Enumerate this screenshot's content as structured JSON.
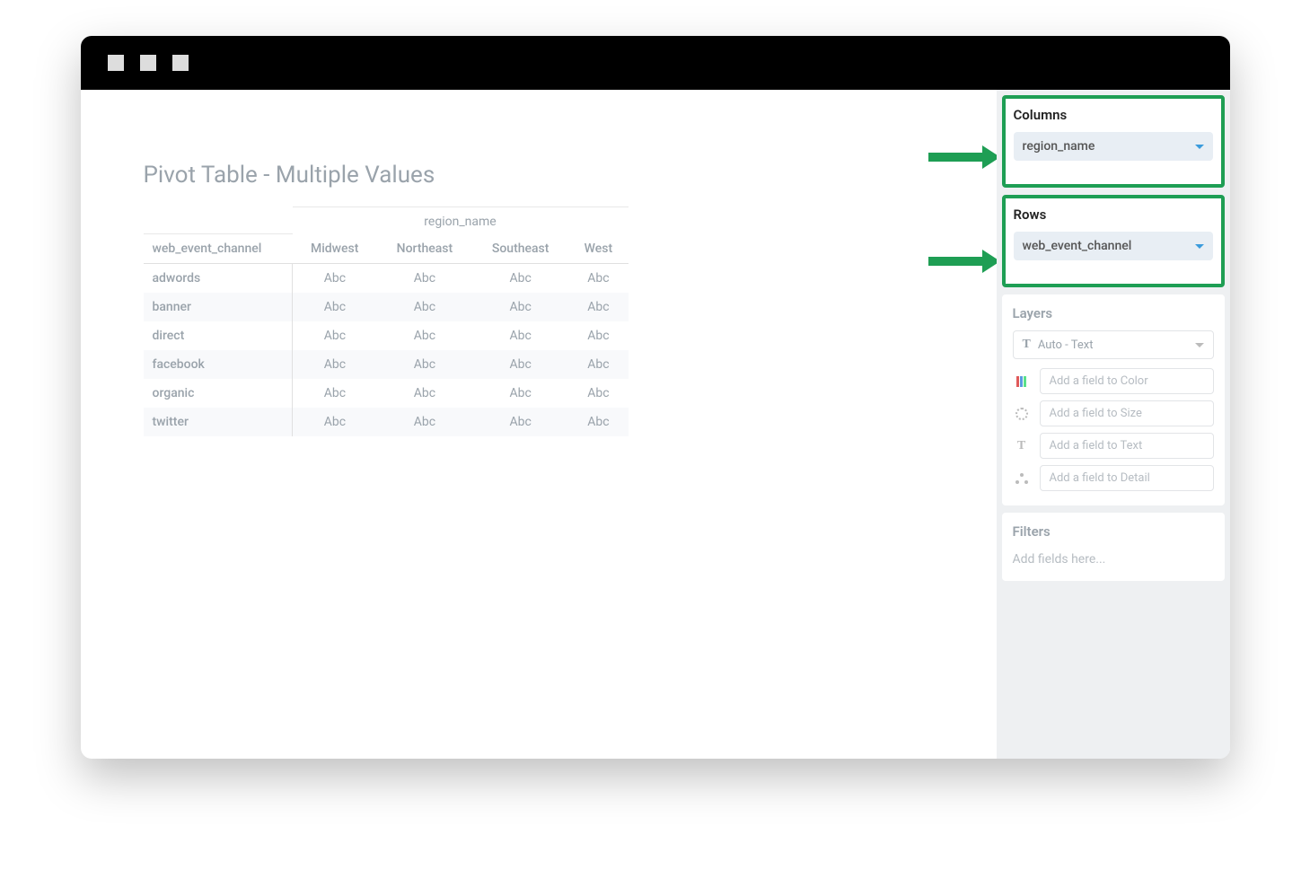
{
  "title": "Pivot Table - Multiple Values",
  "column_field_label": "region_name",
  "row_field_label": "web_event_channel",
  "columns": [
    "Midwest",
    "Northeast",
    "Southeast",
    "West"
  ],
  "rows": [
    "adwords",
    "banner",
    "direct",
    "facebook",
    "organic",
    "twitter"
  ],
  "cell_placeholder": "Abc",
  "sidebar": {
    "columns": {
      "title": "Columns",
      "chip": "region_name"
    },
    "rows": {
      "title": "Rows",
      "chip": "web_event_channel"
    },
    "layers": {
      "title": "Layers",
      "selector": "Auto - Text",
      "fields": {
        "color": "Add a field to Color",
        "size": "Add a field to Size",
        "text": "Add a field to Text",
        "detail": "Add a field to Detail"
      }
    },
    "filters": {
      "title": "Filters",
      "placeholder": "Add fields here..."
    }
  }
}
